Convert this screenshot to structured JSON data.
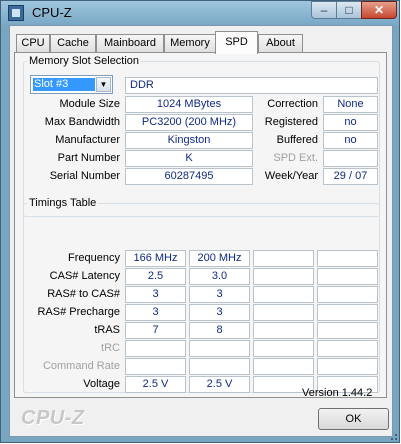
{
  "window": {
    "title": "CPU-Z",
    "min_glyph": "‒",
    "max_glyph": "□",
    "close_glyph": "✕"
  },
  "tabs": [
    {
      "label": "CPU"
    },
    {
      "label": "Cache"
    },
    {
      "label": "Mainboard"
    },
    {
      "label": "Memory"
    },
    {
      "label": "SPD",
      "active": true
    },
    {
      "label": "About"
    }
  ],
  "slot_section": {
    "legend": "Memory Slot Selection",
    "selected_slot": "Slot #3",
    "memory_type": "DDR",
    "rows": {
      "module_size": {
        "label": "Module Size",
        "value": "1024 MBytes"
      },
      "max_bandwidth": {
        "label": "Max Bandwidth",
        "value": "PC3200 (200 MHz)"
      },
      "manufacturer": {
        "label": "Manufacturer",
        "value": "Kingston"
      },
      "part_number": {
        "label": "Part Number",
        "value": "K"
      },
      "serial_number": {
        "label": "Serial Number",
        "value": "60287495"
      }
    },
    "right_rows": {
      "correction": {
        "label": "Correction",
        "value": "None"
      },
      "registered": {
        "label": "Registered",
        "value": "no"
      },
      "buffered": {
        "label": "Buffered",
        "value": "no"
      },
      "spd_ext": {
        "label": "SPD Ext.",
        "value": ""
      },
      "week_year": {
        "label": "Week/Year",
        "value": "29 / 07"
      }
    }
  },
  "timings": {
    "legend": "Timings Table",
    "rows": [
      {
        "label": "Frequency",
        "dim": false,
        "values": [
          "166 MHz",
          "200 MHz",
          "",
          ""
        ]
      },
      {
        "label": "CAS# Latency",
        "dim": false,
        "values": [
          "2.5",
          "3.0",
          "",
          ""
        ]
      },
      {
        "label": "RAS# to CAS#",
        "dim": false,
        "values": [
          "3",
          "3",
          "",
          ""
        ]
      },
      {
        "label": "RAS# Precharge",
        "dim": false,
        "values": [
          "3",
          "3",
          "",
          ""
        ]
      },
      {
        "label": "tRAS",
        "dim": false,
        "values": [
          "7",
          "8",
          "",
          ""
        ]
      },
      {
        "label": "tRC",
        "dim": true,
        "values": [
          "",
          "",
          "",
          ""
        ]
      },
      {
        "label": "Command Rate",
        "dim": true,
        "values": [
          "",
          "",
          "",
          ""
        ]
      },
      {
        "label": "Voltage",
        "dim": false,
        "values": [
          "2.5 V",
          "2.5 V",
          "",
          ""
        ]
      }
    ]
  },
  "footer": {
    "version": "Version 1.44.2",
    "logo": "CPU-Z",
    "ok_label": "OK"
  },
  "colors": {
    "value_text": "#102a87",
    "title_bar": "#79a8c6",
    "selection": "#3399ff"
  }
}
